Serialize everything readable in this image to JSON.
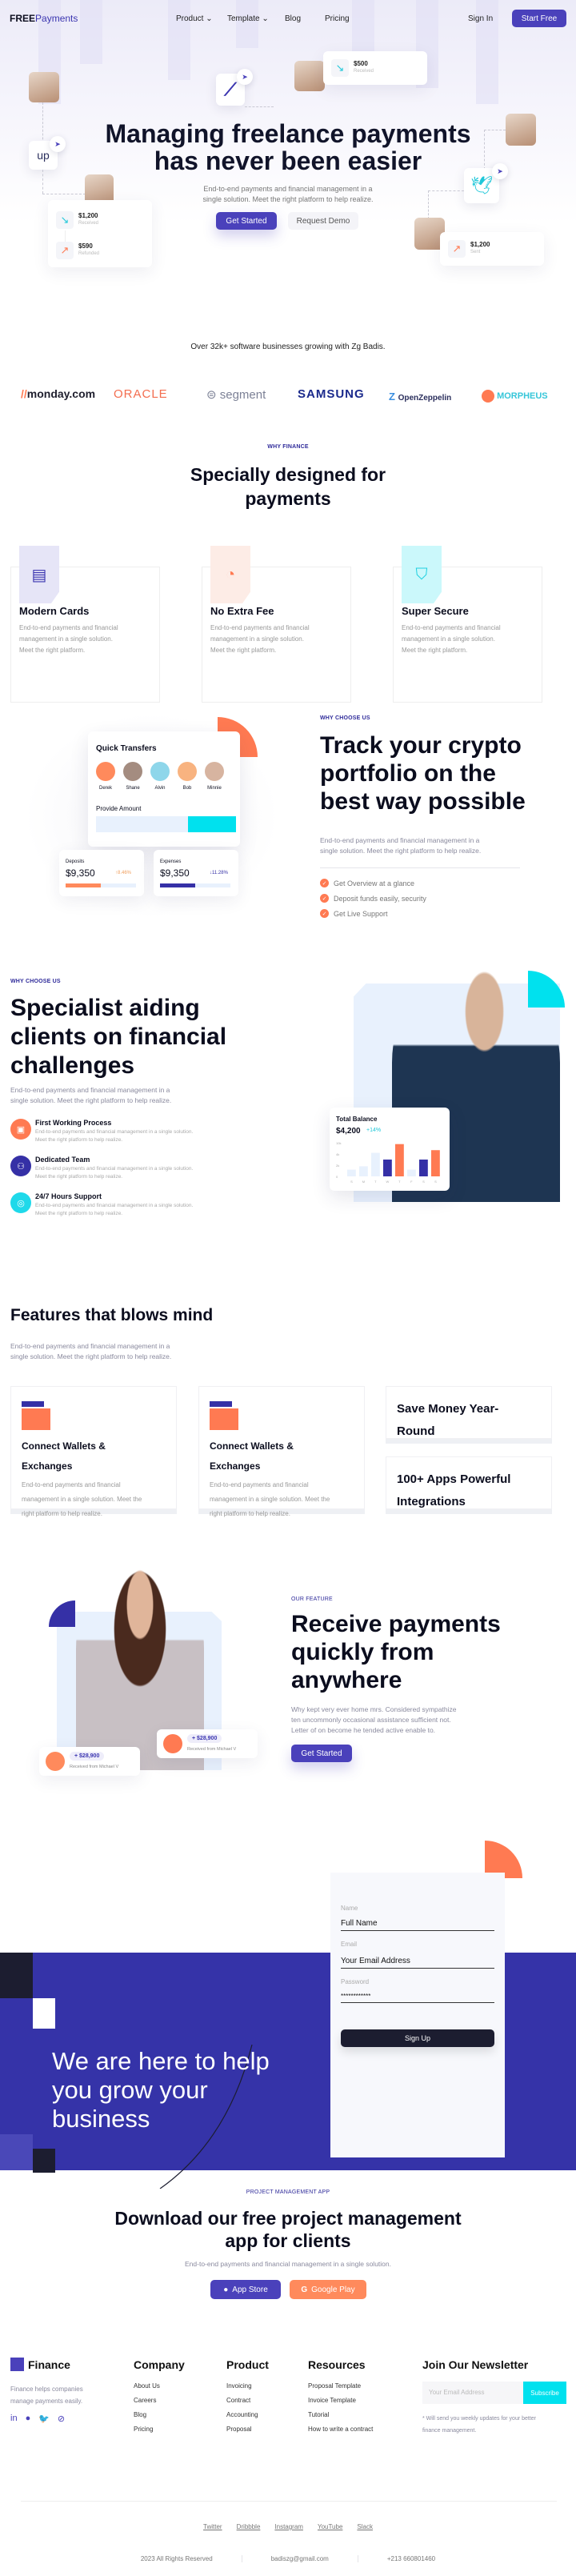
{
  "nav": {
    "logo_bold": "FREE",
    "logo_rest": "Payments",
    "items": [
      {
        "label": "Product",
        "has_dropdown": true
      },
      {
        "label": "Template",
        "has_dropdown": true
      },
      {
        "label": "Blog",
        "has_dropdown": false
      },
      {
        "label": "Pricing",
        "has_dropdown": false
      }
    ],
    "sign_in": "Sign In",
    "start_free": "Start Free"
  },
  "hero": {
    "title_line1": "Managing freelance payments",
    "title_line2": "has never been easier",
    "subtitle_line1": "End-to-end payments and financial management in a",
    "subtitle_line2": "single solution. Meet the right platform to help realize.",
    "cta_primary": "Get Started",
    "cta_secondary": "Request Demo",
    "received_card": {
      "amount": "$500",
      "label": "Received"
    },
    "left_card": [
      {
        "amount": "$1,200",
        "label": "Received",
        "direction": "down"
      },
      {
        "amount": "$590",
        "label": "Refunded",
        "direction": "up"
      }
    ],
    "right_card": {
      "amount": "$1,200",
      "label": "Sent"
    },
    "upwork_text": "up"
  },
  "trust": {
    "text": "Over 32k+ software businesses growing with Zg Badis.",
    "brands": [
      {
        "name": "monday.com",
        "color": "#1f1f2e"
      },
      {
        "name": "ORACLE",
        "color": "#f36d4f"
      },
      {
        "name": "segment",
        "color": "#7c8196"
      },
      {
        "name": "SAMSUNG",
        "color": "#1b2a8c"
      },
      {
        "name": "OpenZeppelin",
        "color": "#2a2e5c"
      },
      {
        "name": "MORPHEUS",
        "color": "#36c6d9"
      }
    ]
  },
  "why_finance": {
    "eyebrow": "WHY FINANCE",
    "title_line1": "Specially designed for",
    "title_line2": "payments",
    "cards": [
      {
        "title": "Modern Cards",
        "icon": "card-icon",
        "bg": "#e6e5f7",
        "fg": "#3b35b0",
        "desc": [
          "End-to-end payments and financial",
          "management in a single solution.",
          "Meet the right platform."
        ]
      },
      {
        "title": "No Extra Fee",
        "icon": "coin-chart-icon",
        "bg": "#fdece6",
        "fg": "#ff7a52",
        "desc": [
          "End-to-end payments and financial",
          "management in a single solution.",
          "Meet the right platform."
        ]
      },
      {
        "title": "Super Secure",
        "icon": "shield-icon",
        "bg": "#cbf8fb",
        "fg": "#1fd0e0",
        "desc": [
          "End-to-end payments and financial",
          "management in a single solution.",
          "Meet the right platform."
        ]
      }
    ]
  },
  "crypto": {
    "eyebrow": "WHY CHOOSE US",
    "title": [
      "Track your crypto",
      "portfolio on the",
      "best way possible"
    ],
    "desc": [
      "End-to-end payments and financial management in a",
      "single solution. Meet the right platform to help realize."
    ],
    "checklist": [
      "Get Overview at a glance",
      "Deposit funds easily, security",
      "Get Live Support"
    ],
    "quick_transfers": {
      "title": "Quick Transfers",
      "people": [
        "Derek",
        "Shane",
        "Alvin",
        "Bob",
        "Minnie"
      ],
      "amount_label": "Provide Amount"
    },
    "deposits": {
      "label": "Deposits",
      "value": "$9,350",
      "change": "8.46%",
      "direction": "up",
      "progress": 0.5
    },
    "expenses": {
      "label": "Expenses",
      "value": "$9,350",
      "change": "11.28%",
      "direction": "down",
      "progress": 0.5
    }
  },
  "specialist": {
    "eyebrow": "WHY CHOOSE US",
    "title": [
      "Specialist aiding",
      "clients on financial",
      "challenges"
    ],
    "desc": [
      "End-to-end payments and financial management in a",
      "single solution. Meet the right platform to help realize."
    ],
    "items": [
      {
        "title": "First Working Process",
        "color": "#ff7a52",
        "icon": "chip-icon",
        "desc": [
          "End-to-end payments and financial management in a single solution.",
          "Meet the right platform to help realize."
        ]
      },
      {
        "title": "Dedicated Team",
        "color": "#3530a6",
        "icon": "team-icon",
        "desc": [
          "End-to-end payments and financial management in a single solution.",
          "Meet the right platform to help realize."
        ]
      },
      {
        "title": "24/7 Hours Support",
        "color": "#1fd9ea",
        "icon": "support-icon",
        "desc": [
          "End-to-end payments and financial management in a single solution.",
          "Meet the right platform to help realize."
        ]
      }
    ],
    "balance": {
      "title": "Total Balance",
      "value": "$4,200",
      "change": "+14%"
    }
  },
  "chart_data": {
    "type": "bar",
    "title": "Total Balance",
    "categories": [
      "S",
      "M",
      "T",
      "W",
      "T",
      "F",
      "S",
      "S"
    ],
    "values": [
      1,
      1.5,
      3.5,
      2.5,
      4.8,
      1,
      2.5,
      3.9
    ],
    "colors": [
      "#e8f1fd",
      "#e8f1fd",
      "#e8f1fd",
      "#3530a6",
      "#ff7a52",
      "#e8f1fd",
      "#3530a6",
      "#ff7a52"
    ],
    "ytick_labels": [
      "0",
      "2k",
      "4k",
      "10k"
    ],
    "ylim": [
      0,
      5
    ]
  },
  "features": {
    "title": "Features that blows mind",
    "desc": [
      "End-to-end payments and financial management in a",
      "single solution. Meet the right platform to help realize."
    ],
    "cards": [
      {
        "title": [
          "Connect Wallets &",
          "Exchanges"
        ],
        "desc": [
          "End-to-end payments and financial",
          "management in a single solution. Meet the",
          "right platform to help realize."
        ]
      },
      {
        "title": [
          "Connect Wallets &",
          "Exchanges"
        ],
        "desc": [
          "End-to-end payments and financial",
          "management in a single solution. Meet the",
          "right platform to help realize."
        ]
      }
    ],
    "small_cards": [
      {
        "title": [
          "Save Money Year-",
          "Round"
        ]
      },
      {
        "title": [
          "100+ Apps Powerful",
          "Integrations"
        ]
      }
    ]
  },
  "receive": {
    "eyebrow": "OUR FEATURE",
    "title": [
      "Receive payments",
      "quickly from",
      "anywhere"
    ],
    "desc": [
      "Why kept very ever home mrs. Considered sympathize",
      "ten uncommonly occasional assistance sufficient not.",
      "Letter of on become he tended active enable to."
    ],
    "cta": "Get Started",
    "notifications": [
      {
        "amount": "+ $28,900",
        "label": "Received from Michael V"
      },
      {
        "amount": "+ $28,900",
        "label": "Received from Michael V"
      }
    ]
  },
  "signup": {
    "headline": [
      "We are here to help",
      "you grow your",
      "business"
    ],
    "fields": [
      {
        "label": "Name",
        "value": "Full Name"
      },
      {
        "label": "Email",
        "value": "Your Email Address"
      },
      {
        "label": "Password",
        "value": "************"
      }
    ],
    "button": "Sign Up"
  },
  "app": {
    "eyebrow": "PROJECT MANAGEMENT APP",
    "title": [
      "Download our free project management",
      "app for clients"
    ],
    "desc": "End-to-end payments and financial management in a single solution.",
    "app_store": "App Store",
    "google_play": "Google Play"
  },
  "footer": {
    "brand": "Finance",
    "about": [
      "Finance helps companies",
      "manage payments easily."
    ],
    "columns": [
      {
        "title": "Company",
        "links": [
          "About Us",
          "Careers",
          "Blog",
          "Pricing"
        ]
      },
      {
        "title": "Product",
        "links": [
          "Invoicing",
          "Contract",
          "Accounting",
          "Proposal"
        ]
      },
      {
        "title": "Resources",
        "links": [
          "Proposal Template",
          "Invoice Template",
          "Tutorial",
          "How to write a contract"
        ]
      }
    ],
    "newsletter": {
      "title": "Join Our Newsletter",
      "placeholder": "Your Email Address",
      "button": "Subscribe",
      "note": [
        "* Will send you weekly updates for your better",
        "finance management."
      ]
    },
    "social_links": [
      "Twitter",
      "Dribbble",
      "Instagram",
      "YouTube",
      "Slack"
    ],
    "copyright": "2023 All Rights Reserved",
    "email": "badiszg@gmail.com",
    "phone": "+213 660801460"
  }
}
